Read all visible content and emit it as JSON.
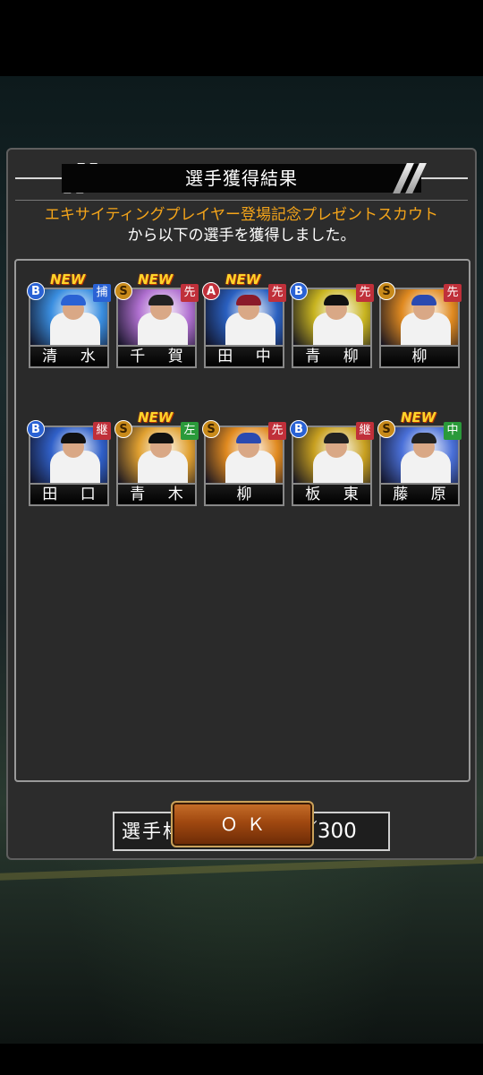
{
  "dialog": {
    "title": "選手獲得結果",
    "message_line1": "エキサイティングプレイヤー登場記念プレゼントスカウト",
    "message_line2": "から以下の選手を獲得しました。"
  },
  "players": [
    {
      "name": "清 水",
      "rank": "B",
      "position": "捕",
      "new": "NEW",
      "pos_color": "#2a62d4",
      "bg": "#3a8ee0",
      "cap": "#2a62d4"
    },
    {
      "name": "千 賀",
      "rank": "S",
      "position": "先",
      "new": "NEW",
      "pos_color": "#c0303a",
      "bg": "#b070d0",
      "cap": "#222222"
    },
    {
      "name": "田 中",
      "rank": "A",
      "position": "先",
      "new": "NEW",
      "pos_color": "#c0303a",
      "bg": "#2a60c0",
      "cap": "#8a1a2a"
    },
    {
      "name": "青 柳",
      "rank": "B",
      "position": "先",
      "new": "",
      "pos_color": "#c0303a",
      "bg": "#c8b420",
      "cap": "#111111"
    },
    {
      "name": "柳",
      "rank": "S",
      "position": "先",
      "new": "",
      "pos_color": "#c0303a",
      "bg": "#e08a20",
      "cap": "#2a4ab0"
    },
    {
      "name": "田 口",
      "rank": "B",
      "position": "継",
      "new": "",
      "pos_color": "#c0303a",
      "bg": "#3060c8",
      "cap": "#111111"
    },
    {
      "name": "青 木",
      "rank": "S",
      "position": "左",
      "new": "NEW",
      "pos_color": "#2a9a3a",
      "bg": "#e0a030",
      "cap": "#111111"
    },
    {
      "name": "柳",
      "rank": "S",
      "position": "先",
      "new": "",
      "pos_color": "#c0303a",
      "bg": "#e08a20",
      "cap": "#2a4ab0"
    },
    {
      "name": "板 東",
      "rank": "B",
      "position": "継",
      "new": "",
      "pos_color": "#c0303a",
      "bg": "#c8a020",
      "cap": "#222222"
    },
    {
      "name": "藤 原",
      "rank": "S",
      "position": "中",
      "new": "NEW",
      "pos_color": "#2a9a3a",
      "bg": "#4a70d8",
      "cap": "#222222"
    }
  ],
  "slots": {
    "label": "選手枠：",
    "value": "206／300"
  },
  "ok_button": {
    "label": "ＯＫ"
  }
}
